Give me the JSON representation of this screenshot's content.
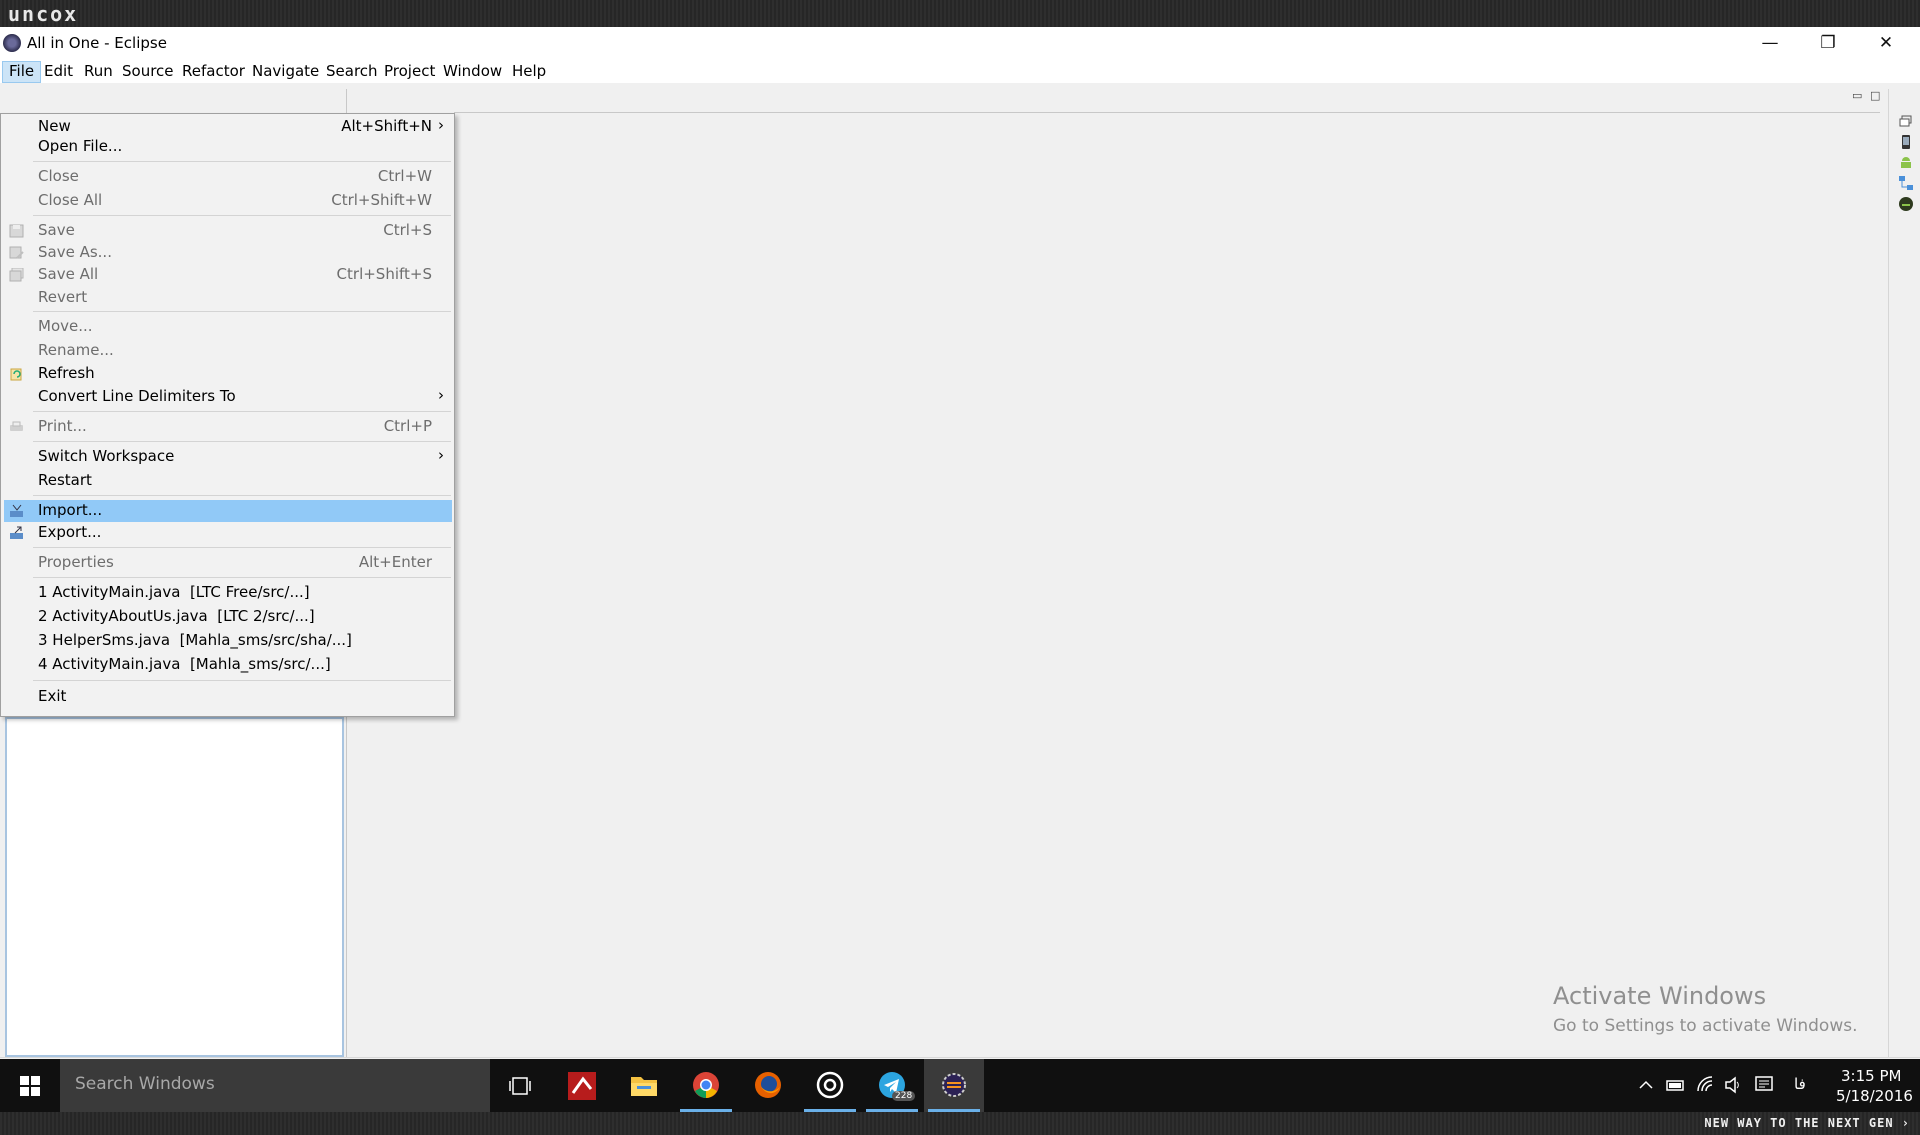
{
  "brand": "uncox",
  "window": {
    "title": "All in One - Eclipse",
    "controls": {
      "minimize": "—",
      "restore": "❐",
      "close": "✕"
    }
  },
  "menubar": [
    "File",
    "Edit",
    "Run",
    "Source",
    "Refactor",
    "Navigate",
    "Search",
    "Project",
    "Window",
    "Help"
  ],
  "file_menu": {
    "new": {
      "label": "New",
      "accel": "Alt+Shift+N"
    },
    "open_file": {
      "label": "Open File..."
    },
    "close": {
      "label": "Close",
      "accel": "Ctrl+W"
    },
    "close_all": {
      "label": "Close All",
      "accel": "Ctrl+Shift+W"
    },
    "save": {
      "label": "Save",
      "accel": "Ctrl+S"
    },
    "save_as": {
      "label": "Save As..."
    },
    "save_all": {
      "label": "Save All",
      "accel": "Ctrl+Shift+S"
    },
    "revert": {
      "label": "Revert"
    },
    "move": {
      "label": "Move..."
    },
    "rename": {
      "label": "Rename..."
    },
    "refresh": {
      "label": "Refresh"
    },
    "convert": {
      "label": "Convert Line Delimiters To"
    },
    "print": {
      "label": "Print...",
      "accel": "Ctrl+P"
    },
    "switch_workspace": {
      "label": "Switch Workspace"
    },
    "restart": {
      "label": "Restart"
    },
    "import": {
      "label": "Import..."
    },
    "export": {
      "label": "Export..."
    },
    "properties": {
      "label": "Properties",
      "accel": "Alt+Enter"
    },
    "recent": [
      "1 ActivityMain.java  [LTC Free/src/...]",
      "2 ActivityAboutUs.java  [LTC 2/src/...]",
      "3 HelperSms.java  [Mahla_sms/src/sha/...]",
      "4 ActivityMain.java  [Mahla_sms/src/...]"
    ],
    "exit": {
      "label": "Exit"
    }
  },
  "watermark": {
    "line1": "Activate Windows",
    "line2": "Go to Settings to activate Windows."
  },
  "taskbar": {
    "search_placeholder": "Search Windows",
    "telegram_badge": "228",
    "time": "3:15 PM",
    "date": "5/18/2016",
    "lang": "فا"
  },
  "tagline": "NEW WAY TO THE NEXT GEN ›",
  "colors": {
    "highlight": "#91c9f7",
    "menu_active": "#cce4f7",
    "taskbar": "#101010"
  }
}
